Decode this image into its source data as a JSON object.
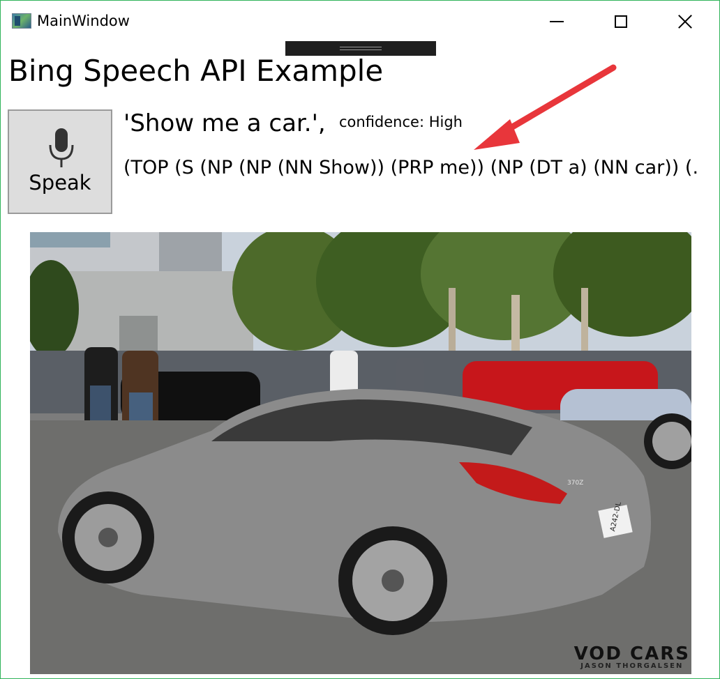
{
  "window": {
    "title": "MainWindow",
    "border_color": "#2fb35a"
  },
  "title_bar": {
    "minimize_icon": "minimize-icon",
    "maximize_icon": "maximize-icon",
    "close_icon": "close-icon"
  },
  "main": {
    "heading": "Bing Speech API Example",
    "speak_button": {
      "label": "Speak",
      "icon": "microphone-icon"
    },
    "recognized_text": "'Show me a car.',",
    "confidence": "confidence: High",
    "parse_tree": "(TOP (S (NP (NP (NN Show)) (PRP me)) (NP (DT a) (NN car)) (.",
    "annotation_arrow_color": "#e8363b"
  },
  "photo": {
    "description_icon": "car-photo",
    "watermark": {
      "main": "VOD CARS",
      "sub": "JASON THORGALSEN"
    },
    "plate_text": "A242-DL",
    "badge_text": "370Z"
  }
}
